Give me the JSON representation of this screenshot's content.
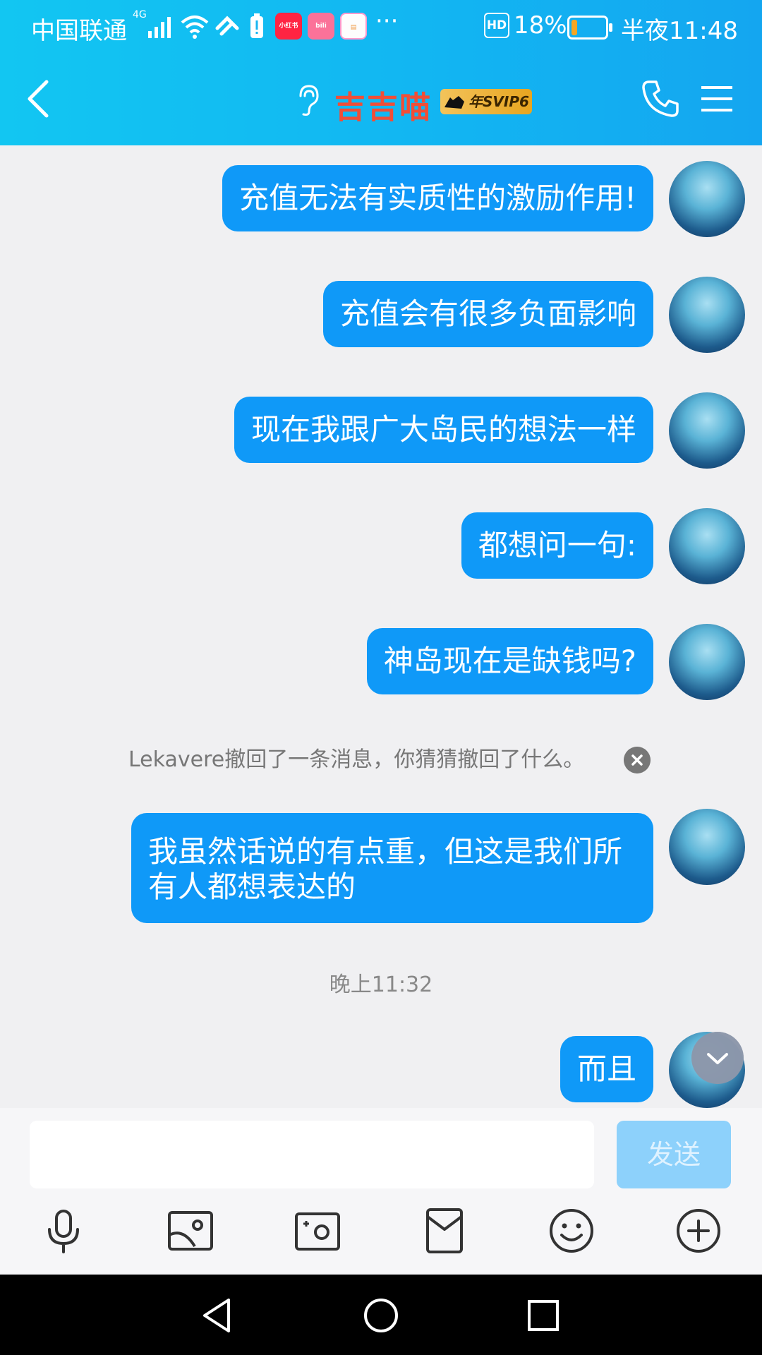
{
  "status_bar": {
    "carrier": "中国联通",
    "signal_label": "4G",
    "more": "···",
    "hd_label": "HD",
    "battery_percent": "18%",
    "battery_level": 0.18,
    "time": "半夜11:48"
  },
  "header": {
    "title": "吉吉喵",
    "badge_text": "年SVIP6"
  },
  "messages": [
    {
      "type": "sent",
      "text": "充值无法有实质性的激励作用!"
    },
    {
      "type": "sent",
      "text": "充值会有很多负面影响"
    },
    {
      "type": "sent",
      "text": "现在我跟广大岛民的想法一样"
    },
    {
      "type": "sent",
      "text": "都想问一句:"
    },
    {
      "type": "sent",
      "text": "神岛现在是缺钱吗?"
    },
    {
      "type": "system",
      "text": "Lekavere撤回了一条消息，你猜猜撤回了什么。"
    },
    {
      "type": "sent",
      "text": "我虽然话说的有点重，但这是我们所有人都想表达的"
    },
    {
      "type": "timestamp",
      "text": "晚上11:32"
    },
    {
      "type": "sent",
      "text": "而且"
    }
  ],
  "input": {
    "value": "",
    "placeholder": "",
    "send_label": "发送"
  },
  "toolbar_icons": [
    "microphone-icon",
    "image-icon",
    "camera-icon",
    "red-packet-icon",
    "emoji-icon",
    "plus-icon"
  ],
  "colors": {
    "header_gradient": [
      "#12c6f2",
      "#14a6f0"
    ],
    "bubble": "#0f99f8",
    "title": "#f04e37",
    "send_disabled": "#8dd1fb"
  }
}
